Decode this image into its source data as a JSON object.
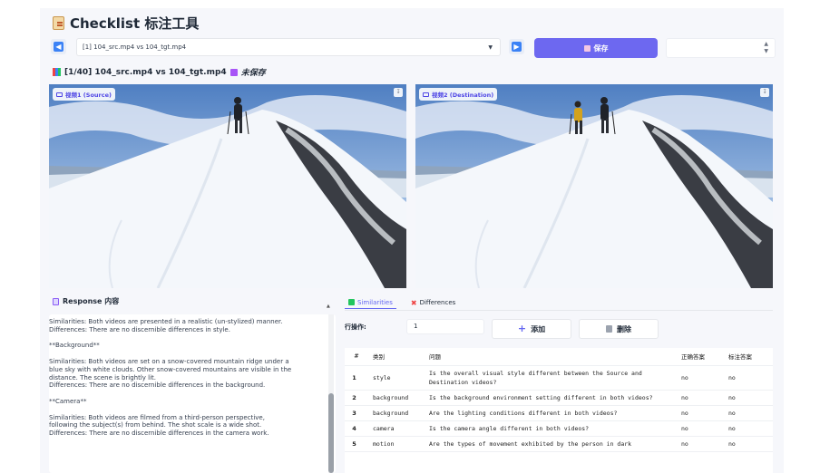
{
  "app": {
    "title": "Checklist 标注工具"
  },
  "toolbar": {
    "select_value": "[1] 104_src.mp4 vs 104_tgt.mp4",
    "save_label": "保存",
    "prev_icon": "arrow-left-icon",
    "next_icon": "arrow-right-icon"
  },
  "subtitle": {
    "text": "[1/40] 104_src.mp4 vs 104_tgt.mp4",
    "status": "未保存"
  },
  "videos": [
    {
      "label": "视频1 (Source)"
    },
    {
      "label": "视频2 (Destination)"
    }
  ],
  "response": {
    "title": "Response 内容",
    "paragraphs": [
      "Similarities: Both videos are presented in a realistic (un-stylized) manner.\nDifferences: There are no discernible differences in style.",
      "**Background**",
      "Similarities: Both videos are set on a snow-covered mountain ridge under a\nblue sky with white clouds. Other snow-covered mountains are visible in the\ndistance. The scene is brightly lit.\nDifferences: There are no discernible differences in the background.",
      "**Camera**",
      "Similarities: Both videos are filmed from a third-person perspective,\nfollowing the subject(s) from behind. The shot scale is a wide shot.\nDifferences: There are no discernible differences in the camera work."
    ]
  },
  "tabs": [
    {
      "label": "Similarities",
      "active": true
    },
    {
      "label": "Differences",
      "active": false
    }
  ],
  "row_ops": {
    "label": "行操作:",
    "value": "1",
    "add_label": "添加",
    "delete_label": "删除"
  },
  "table": {
    "headers": [
      "#",
      "类别",
      "问题",
      "正确答案",
      "标注答案"
    ],
    "rows": [
      {
        "n": "1",
        "cat": "style",
        "q": "Is the overall visual style different between the Source and Destination videos?",
        "a": "no",
        "b": "no"
      },
      {
        "n": "2",
        "cat": "background",
        "q": "Is the background environment setting different in both videos?",
        "a": "no",
        "b": "no"
      },
      {
        "n": "3",
        "cat": "background",
        "q": "Are the lighting conditions different in both videos?",
        "a": "no",
        "b": "no"
      },
      {
        "n": "4",
        "cat": "camera",
        "q": "Is the camera angle different in both videos?",
        "a": "no",
        "b": "no"
      },
      {
        "n": "5",
        "cat": "motion",
        "q": "Are the types of movement exhibited by the person in dark",
        "a": "no",
        "b": "no"
      }
    ]
  }
}
